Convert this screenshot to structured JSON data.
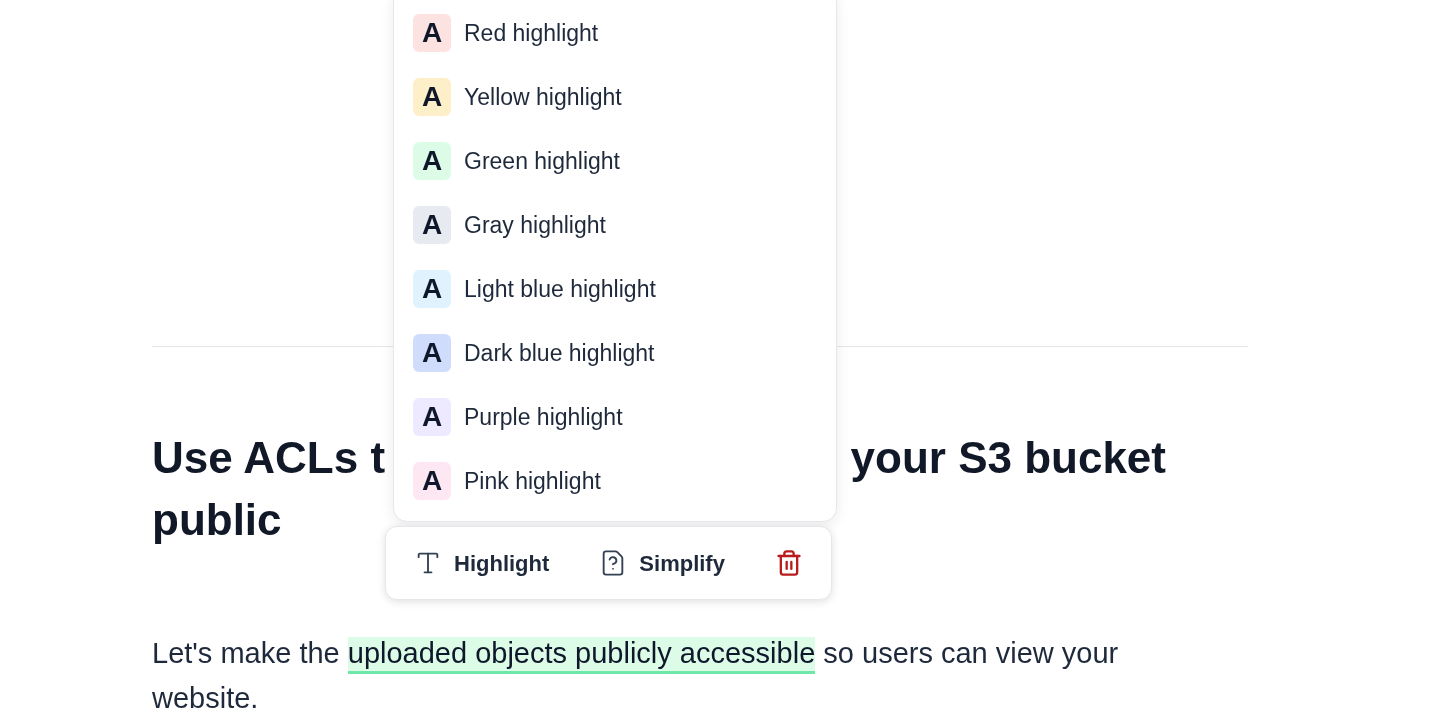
{
  "heading": {
    "line_1_start": "Use ACLs t",
    "line_1_end": "your S3 bucket",
    "line_2": "public"
  },
  "paragraph": {
    "segments": [
      {
        "text": "Let's make the ",
        "highlighted": false
      },
      {
        "text": "uploaded objects publicly accessible",
        "highlighted": true,
        "color": "#dcfce7"
      },
      {
        "text": " so users can view your website.",
        "highlighted": false
      }
    ]
  },
  "highlight_menu": {
    "items": [
      {
        "letter": "A",
        "label": "Red highlight",
        "color": "#fde2e2"
      },
      {
        "letter": "A",
        "label": "Yellow highlight",
        "color": "#fdefc7"
      },
      {
        "letter": "A",
        "label": "Green highlight",
        "color": "#dcfce7"
      },
      {
        "letter": "A",
        "label": "Gray highlight",
        "color": "#e8eaf1"
      },
      {
        "letter": "A",
        "label": "Light blue highlight",
        "color": "#e0f2fe"
      },
      {
        "letter": "A",
        "label": "Dark blue highlight",
        "color": "#cfdcfb"
      },
      {
        "letter": "A",
        "label": "Purple highlight",
        "color": "#ede9fe"
      },
      {
        "letter": "A",
        "label": "Pink highlight",
        "color": "#fce7f3"
      }
    ]
  },
  "toolbar": {
    "buttons": [
      {
        "kind": "highlight",
        "label": "Highlight"
      },
      {
        "kind": "simplify",
        "label": "Simplify"
      },
      {
        "kind": "delete"
      }
    ]
  }
}
